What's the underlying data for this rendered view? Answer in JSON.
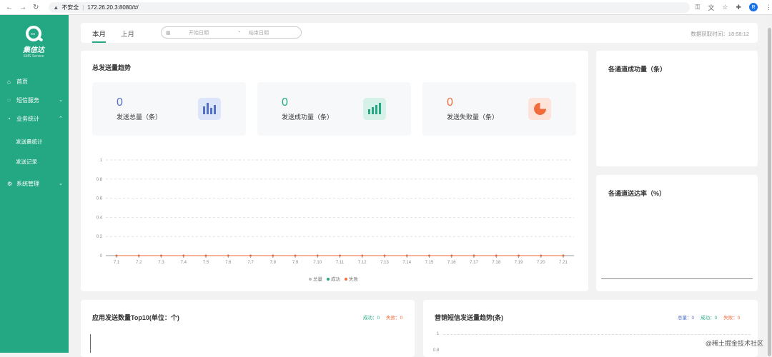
{
  "browser": {
    "insecure_label": "不安全",
    "url": "172.26.20.3:8080/#/"
  },
  "sidebar": {
    "logo_name": "集信达",
    "logo_sub": "SMS Service",
    "items": [
      {
        "label": "首页"
      },
      {
        "label": "短信服务"
      },
      {
        "label": "业务统计"
      },
      {
        "label": "发送量统计"
      },
      {
        "label": "发送记录"
      },
      {
        "label": "系统管理"
      }
    ]
  },
  "topbar": {
    "tab_this_month": "本月",
    "tab_last_month": "上月",
    "start_placeholder": "开始日期",
    "end_placeholder": "结束日期",
    "range_sep": "-",
    "fetch_time": "数据获取时间：18:58:12"
  },
  "trend": {
    "title": "总发送量趋势",
    "stats": [
      {
        "value": "0",
        "label": "发送总量（条）",
        "color": "#5470c6"
      },
      {
        "value": "0",
        "label": "发送成功量（条）",
        "color": "#23a883"
      },
      {
        "value": "0",
        "label": "发送失败量（条）",
        "color": "#f26b3a"
      }
    ],
    "legend": [
      "总量",
      "成功",
      "失败"
    ]
  },
  "chart_data": {
    "type": "line",
    "x": [
      "7.1",
      "7.2",
      "7.3",
      "7.4",
      "7.5",
      "7.6",
      "7.7",
      "7.8",
      "7.9",
      "7.10",
      "7.11",
      "7.12",
      "7.13",
      "7.14",
      "7.15",
      "7.16",
      "7.17",
      "7.18",
      "7.19",
      "7.20",
      "7.21"
    ],
    "ylim": [
      0,
      1
    ],
    "yticks": [
      "1",
      "0.8",
      "0.6",
      "0.4",
      "0.2",
      "0"
    ],
    "series": [
      {
        "name": "总量",
        "color": "#5470c6",
        "values": [
          0,
          0,
          0,
          0,
          0,
          0,
          0,
          0,
          0,
          0,
          0,
          0,
          0,
          0,
          0,
          0,
          0,
          0,
          0,
          0,
          0
        ]
      },
      {
        "name": "成功",
        "color": "#23a883",
        "values": [
          0,
          0,
          0,
          0,
          0,
          0,
          0,
          0,
          0,
          0,
          0,
          0,
          0,
          0,
          0,
          0,
          0,
          0,
          0,
          0,
          0
        ]
      },
      {
        "name": "失败",
        "color": "#f26b3a",
        "values": [
          0,
          0,
          0,
          0,
          0,
          0,
          0,
          0,
          0,
          0,
          0,
          0,
          0,
          0,
          0,
          0,
          0,
          0,
          0,
          0,
          0
        ]
      }
    ],
    "grid": true,
    "legend_position": "bottom"
  },
  "channel_success": {
    "title": "各通道成功量（条）"
  },
  "channel_rate": {
    "title": "各通道送达率（%）"
  },
  "top10": {
    "title": "应用发送数量Top10(单位：个)",
    "success_label": "成功：0",
    "fail_label": "失败：0"
  },
  "marketing": {
    "title": "营销短信发送量趋势(条)",
    "total_label": "总量：0",
    "success_label": "成功：0",
    "fail_label": "失败：0",
    "ytick_top": "1",
    "ytick_second": "0.8"
  },
  "watermark": "@稀土掘金技术社区"
}
